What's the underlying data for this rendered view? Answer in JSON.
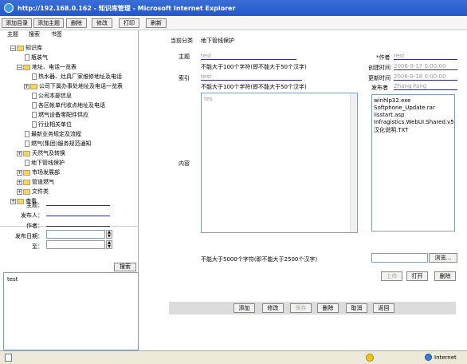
{
  "window": {
    "title": "http://192.168.0.162 - 知识库管理 - Microsoft Internet Explorer"
  },
  "toolbar": {
    "buttons": [
      "添加目录",
      "添加主题",
      "删除",
      "修改",
      "打印",
      "刷新"
    ]
  },
  "left_tabs": [
    "主题",
    "搜索",
    "书签"
  ],
  "tree": {
    "root": "知识库",
    "items": [
      "瓶装气",
      "地址、电话一览表",
      "热水器、灶具厂家维修地址及电话",
      "公司下属办事处地址及电话一览表",
      "公司本部信息",
      "各区帐单代收点地址及电话",
      "燃气设备零配件供应",
      "行业相关单位",
      "最新业务规定及流程",
      "燃气(集团)服务规范通知",
      "天然气及转换",
      "地下管线保护",
      "市场发展部",
      "管道燃气",
      "文件类",
      "查看"
    ]
  },
  "search_form": {
    "subject_label": "主题：",
    "publisher_label": "发布人：",
    "author_label": "作者：",
    "date_label": "发布日期：",
    "to_label": "至：",
    "search_button": "搜索",
    "results": [
      "test"
    ]
  },
  "form": {
    "category_label": "当前分类",
    "category_value": "地下管线保护",
    "subject_label": "主题",
    "subject_value": "test",
    "subject_hint": "不能大于100个字符(即不能大于50个汉字)",
    "index_label": "索引",
    "index_value": "test",
    "index_hint": "不能大于100个字符(即不能大于50个汉字)",
    "content_label": "内容",
    "content_value": "tes",
    "content_hint": "不能大于5000个字符(即不能大于2500个汉字)",
    "author_label": "*作者",
    "author_value": "test",
    "created_label": "创建时间",
    "created_value": "2006-9-17 0:00:00",
    "updated_label": "更新时间",
    "updated_value": "2006-9-18 0:00:00",
    "publisher_label": "发布者",
    "publisher_value": "Zhang Fang",
    "attachments": [
      "winhlp32.exe",
      "Softphone_Update.rar",
      "iisstart.asp",
      "Infragistics.WebUI.Shared.v5",
      "汉化说明.TXT"
    ],
    "browse_button": "浏览...",
    "upload_button": "上传",
    "open_button": "打开",
    "delete_attach_button": "删除"
  },
  "actions": [
    "添加",
    "修改",
    "保存",
    "删除",
    "取消",
    "返回"
  ],
  "status": {
    "zone": "Internet"
  }
}
